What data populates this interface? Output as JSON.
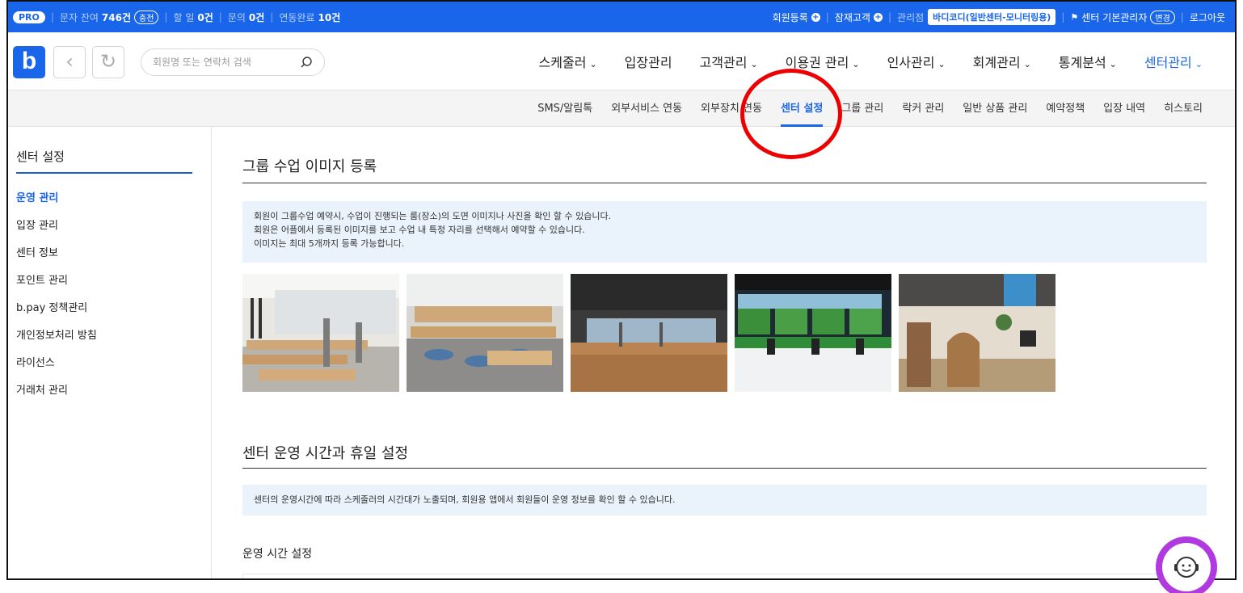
{
  "topbar": {
    "pro": "PRO",
    "sms_label": "문자 잔여",
    "sms_value": "746건",
    "sms_btn": "충전",
    "discount_label": "할 일",
    "discount_value": "0건",
    "inquiry_label": "문의",
    "inquiry_value": "0건",
    "linked_label": "연동완료",
    "linked_value": "10건",
    "member_register": "회원등록",
    "prospect": "잠재고객",
    "manage_label": "관리점",
    "branch": "바디코디(일반센터-모니터링용)",
    "admin": "센터 기본관리자",
    "change_btn": "변경",
    "logout": "로그아웃"
  },
  "header": {
    "logo": "b",
    "back_icon": "‹",
    "refresh_icon": "↻",
    "search_placeholder": "회원명 또는 연락처 검색",
    "nav": [
      {
        "label": "스케줄러",
        "chev": "⌄"
      },
      {
        "label": "입장관리",
        "chev": ""
      },
      {
        "label": "고객관리",
        "chev": "⌄"
      },
      {
        "label": "이용권 관리",
        "chev": "⌄"
      },
      {
        "label": "인사관리",
        "chev": "⌄"
      },
      {
        "label": "회계관리",
        "chev": "⌄"
      },
      {
        "label": "통계분석",
        "chev": "⌄"
      },
      {
        "label": "센터관리",
        "chev": "⌄"
      }
    ]
  },
  "subnav": [
    "SMS/알림톡",
    "외부서비스 연동",
    "외부장치 연동",
    "센터 설정",
    "그룹 관리",
    "락커 관리",
    "일반 상품 관리",
    "예약정책",
    "입장 내역",
    "히스토리"
  ],
  "sidebar": {
    "title": "센터 설정",
    "items": [
      "운영 관리",
      "입장 관리",
      "센터 정보",
      "포인트 관리",
      "b.pay 정책관리",
      "개인정보처리 방침",
      "라이선스",
      "거래처 관리"
    ]
  },
  "section1": {
    "title": "그룹 수업 이미지 등록",
    "lines": [
      "회원이 그룹수업 예약시, 수업이 진행되는 룸(장소)의 도면 이미지나 사진을 확인 할 수 있습니다.",
      "회원은 어플에서 등록된 이미지를 보고 수업 내 특정 자리를 선택해서 예약할 수 있습니다.",
      "이미지는 최대 5개까지 등록 가능합니다."
    ]
  },
  "section2": {
    "title": "센터 운영 시간과 휴일 설정",
    "line": "센터의 운영시간에 따라 스케줄러의 시간대가 노출되며, 회원용 앱에서 회원들이 운영 정보를 확인 할 수 있습니다.",
    "sub_title": "운영 시간 설정"
  },
  "colors": {
    "brand": "#1a66ea",
    "highlight": "#e00000"
  }
}
